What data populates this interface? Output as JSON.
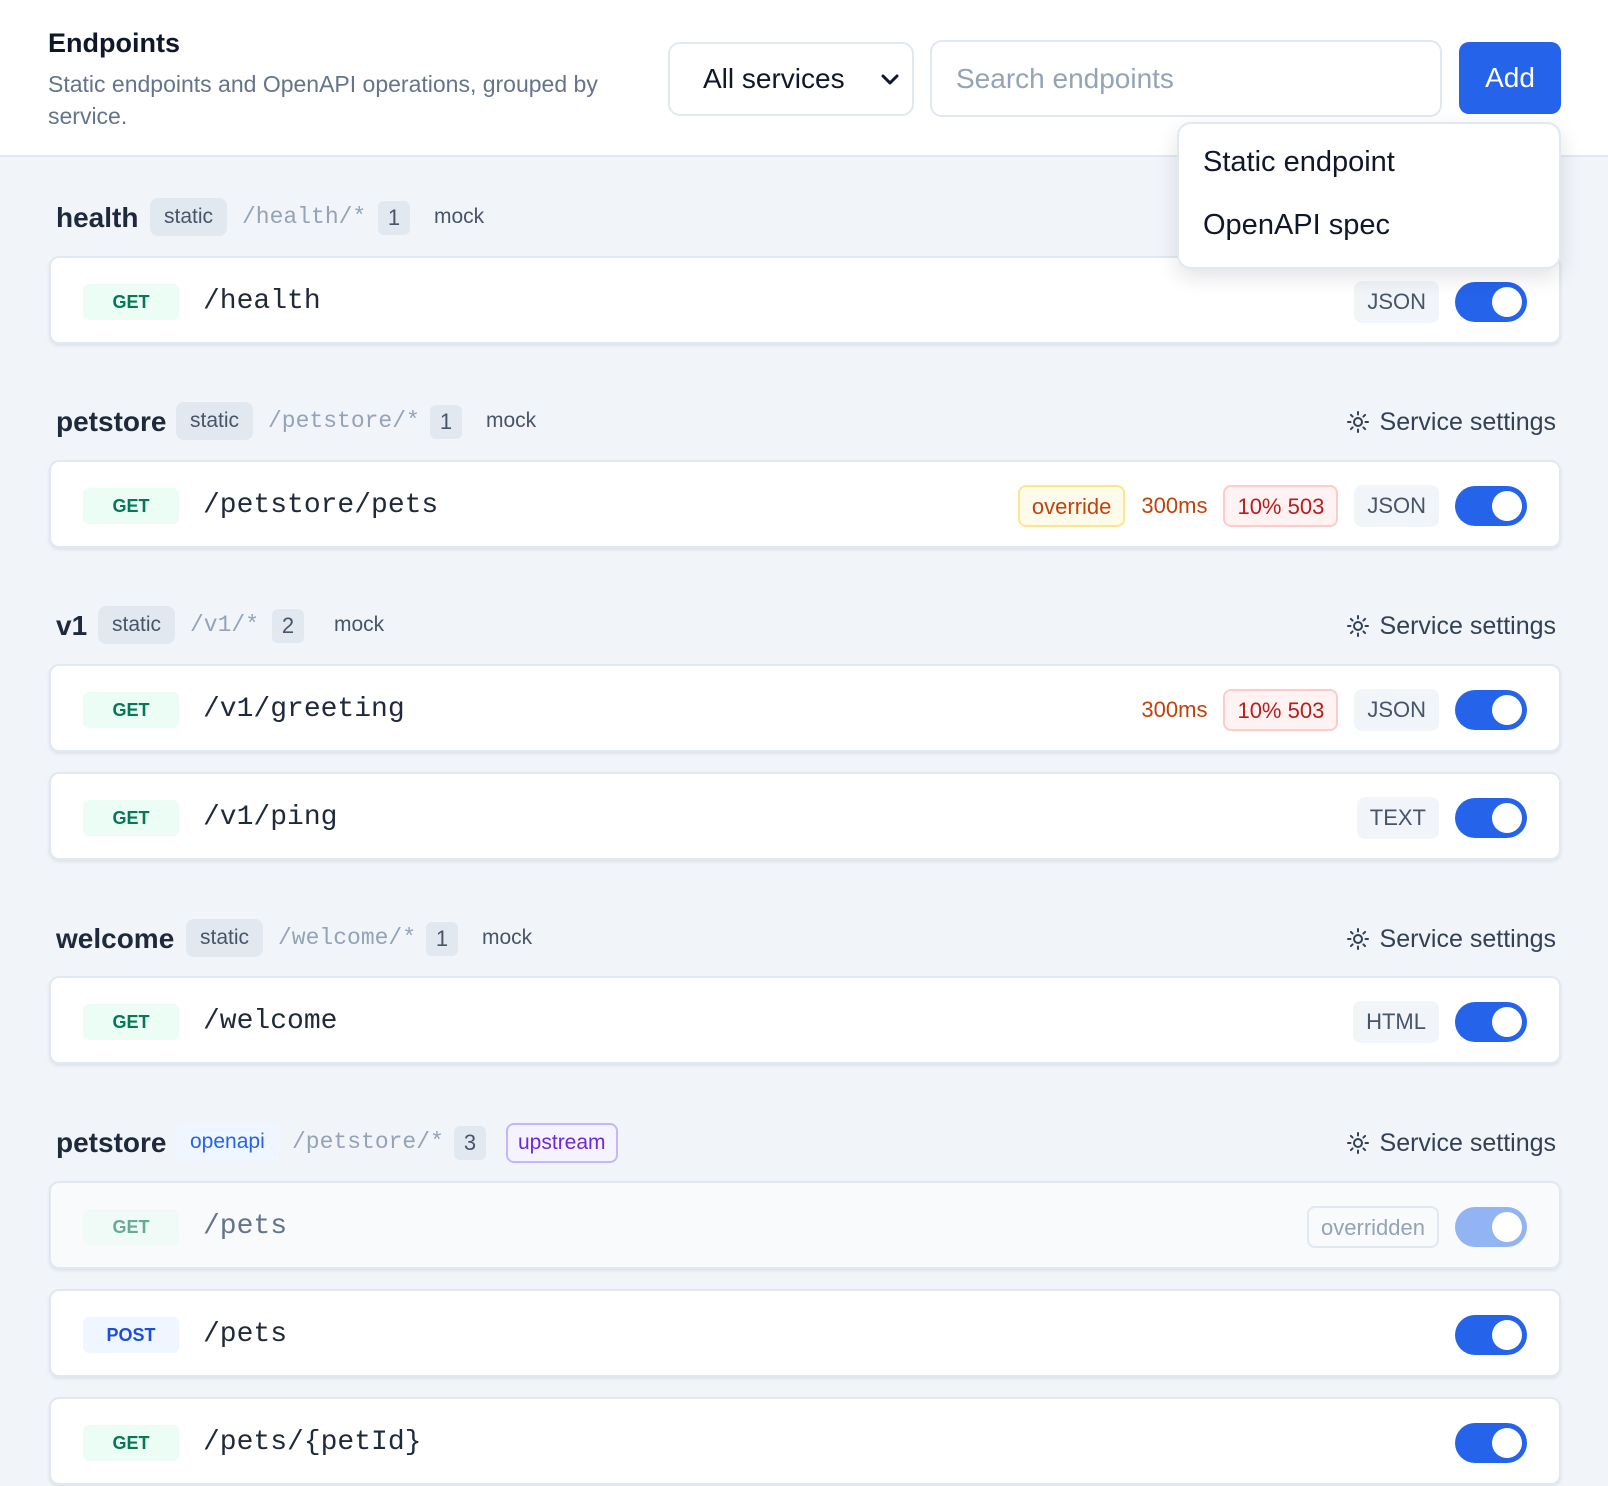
{
  "header": {
    "title": "Endpoints",
    "subtitle": "Static endpoints and OpenAPI operations, grouped by service.",
    "service_filter": "All services",
    "search_placeholder": "Search endpoints",
    "add_label": "Add"
  },
  "add_menu": {
    "items": [
      "Static endpoint",
      "OpenAPI spec"
    ]
  },
  "settings_label": "Service settings",
  "colors": {
    "accent": "#2563eb",
    "get": "#047857",
    "post": "#1d4ed8",
    "warning": "#c2410c",
    "error": "#b91c1c",
    "upstream": "#6d28d9"
  },
  "groups": [
    {
      "name": "health",
      "kind": "static",
      "prefix": "/health/*",
      "count": "1",
      "mode": "mock",
      "endpoints": [
        {
          "method": "GET",
          "path": "/health",
          "type": "JSON",
          "enabled": true
        }
      ]
    },
    {
      "name": "petstore",
      "kind": "static",
      "prefix": "/petstore/*",
      "count": "1",
      "mode": "mock",
      "endpoints": [
        {
          "method": "GET",
          "path": "/petstore/pets",
          "override": "override",
          "latency": "300ms",
          "error": "10% 503",
          "type": "JSON",
          "enabled": true
        }
      ]
    },
    {
      "name": "v1",
      "kind": "static",
      "prefix": "/v1/*",
      "count": "2",
      "mode": "mock",
      "endpoints": [
        {
          "method": "GET",
          "path": "/v1/greeting",
          "latency": "300ms",
          "error": "10% 503",
          "type": "JSON",
          "enabled": true
        },
        {
          "method": "GET",
          "path": "/v1/ping",
          "type": "TEXT",
          "enabled": true
        }
      ]
    },
    {
      "name": "welcome",
      "kind": "static",
      "prefix": "/welcome/*",
      "count": "1",
      "mode": "mock",
      "endpoints": [
        {
          "method": "GET",
          "path": "/welcome",
          "type": "HTML",
          "enabled": true
        }
      ]
    },
    {
      "name": "petstore",
      "kind": "openapi",
      "prefix": "/petstore/*",
      "count": "3",
      "mode": "upstream",
      "endpoints": [
        {
          "method": "GET",
          "path": "/pets",
          "status": "overridden",
          "enabled": true
        },
        {
          "method": "POST",
          "path": "/pets",
          "enabled": true
        },
        {
          "method": "GET",
          "path": "/pets/{petId}",
          "enabled": true
        }
      ]
    }
  ]
}
